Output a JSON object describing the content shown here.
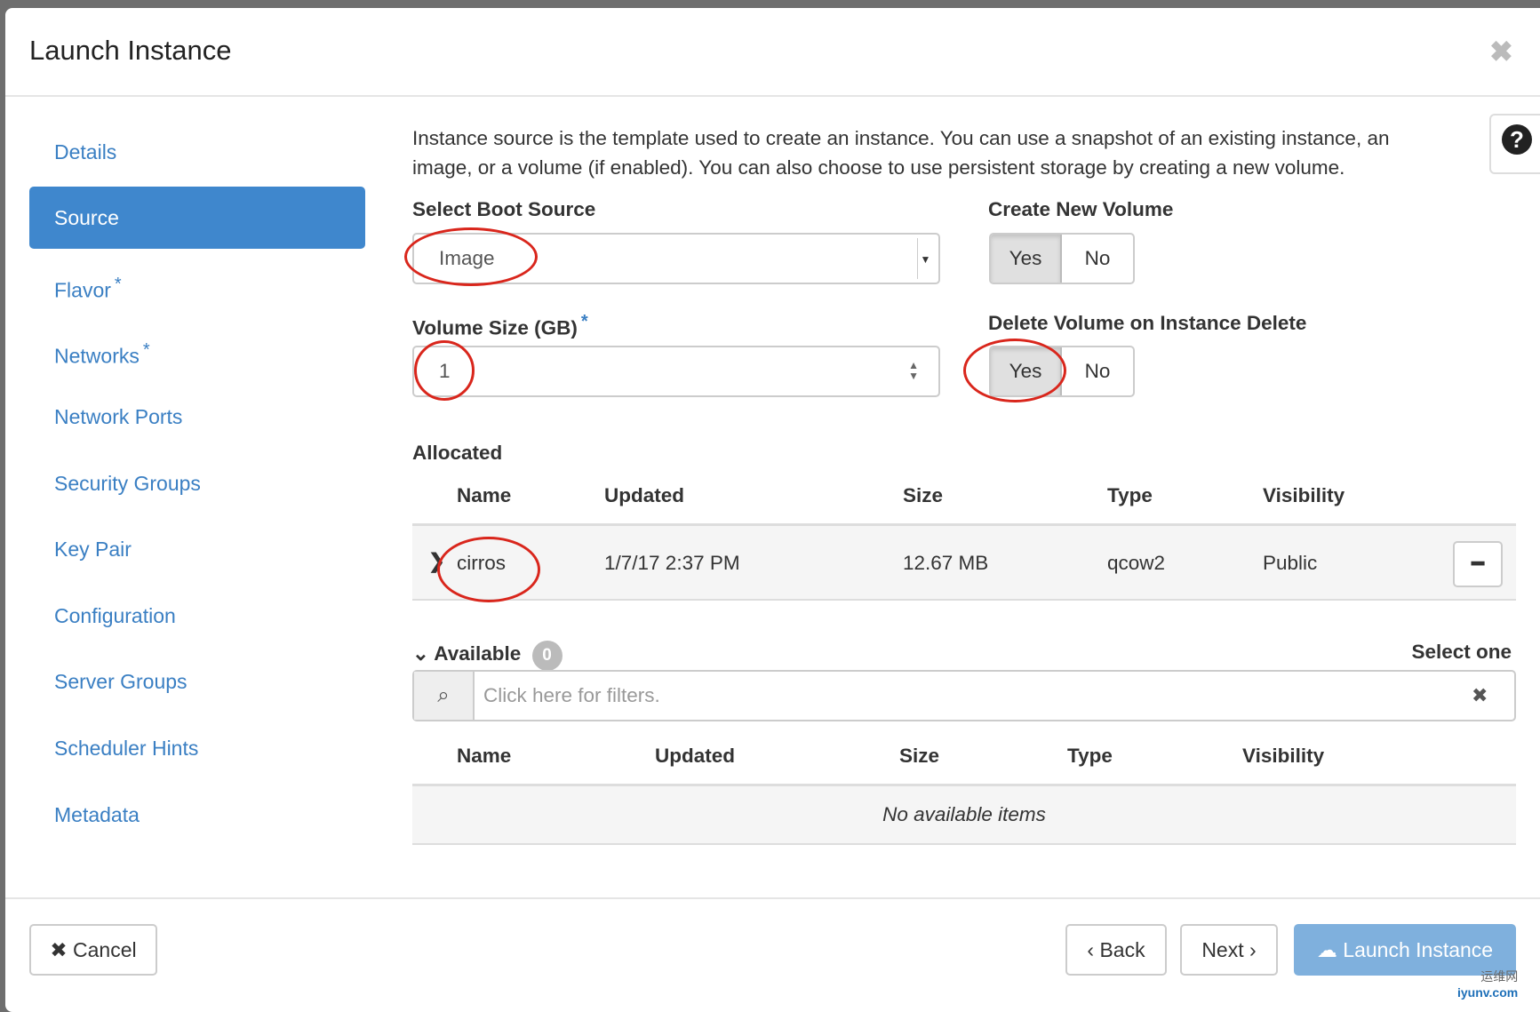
{
  "modal": {
    "title": "Launch Instance",
    "close_icon": "times-icon"
  },
  "sidebar": {
    "items": [
      {
        "label": "Details",
        "required": false
      },
      {
        "label": "Source",
        "required": false,
        "active": true
      },
      {
        "label": "Flavor",
        "required": true
      },
      {
        "label": "Networks",
        "required": true
      },
      {
        "label": "Network Ports",
        "required": false
      },
      {
        "label": "Security Groups",
        "required": false
      },
      {
        "label": "Key Pair",
        "required": false
      },
      {
        "label": "Configuration",
        "required": false
      },
      {
        "label": "Server Groups",
        "required": false
      },
      {
        "label": "Scheduler Hints",
        "required": false
      },
      {
        "label": "Metadata",
        "required": false
      }
    ],
    "required_mark": "*"
  },
  "source": {
    "description": "Instance source is the template used to create an instance. You can use a snapshot of an existing instance, an image, or a volume (if enabled). You can also choose to use persistent storage by creating a new volume.",
    "help_icon": "?",
    "boot_source_label": "Select Boot Source",
    "boot_source_value": "Image",
    "create_volume_label": "Create New Volume",
    "create_volume_yes": "Yes",
    "create_volume_no": "No",
    "create_volume_selected": "Yes",
    "volume_size_label": "Volume Size (GB)",
    "volume_size_required": "*",
    "volume_size_value": "1",
    "delete_volume_label": "Delete Volume on Instance Delete",
    "delete_volume_yes": "Yes",
    "delete_volume_no": "No",
    "delete_volume_selected": "Yes"
  },
  "allocated": {
    "title": "Allocated",
    "columns": [
      "Name",
      "Updated",
      "Size",
      "Type",
      "Visibility"
    ],
    "rows": [
      {
        "name": "cirros",
        "updated": "1/7/17 2:37 PM",
        "size": "12.67 MB",
        "type": "qcow2",
        "visibility": "Public",
        "expand_icon": "chevron-right-icon",
        "remove_icon": "minus-icon"
      }
    ]
  },
  "available": {
    "title": "Available",
    "count": "0",
    "select_hint": "Select one",
    "filter_placeholder": "Click here for filters.",
    "columns": [
      "Name",
      "Updated",
      "Size",
      "Type",
      "Visibility"
    ],
    "empty_text": "No available items"
  },
  "footer": {
    "cancel": "Cancel",
    "back": "Back",
    "next": "Next",
    "launch": "Launch Instance"
  },
  "watermark": {
    "text_cn": "运维网",
    "text": "iyunv.com"
  },
  "colors": {
    "accent": "#3f87cd",
    "link": "#3a7fc3",
    "launch_disabled": "#7fb0dd",
    "annotation": "#d9261c"
  }
}
